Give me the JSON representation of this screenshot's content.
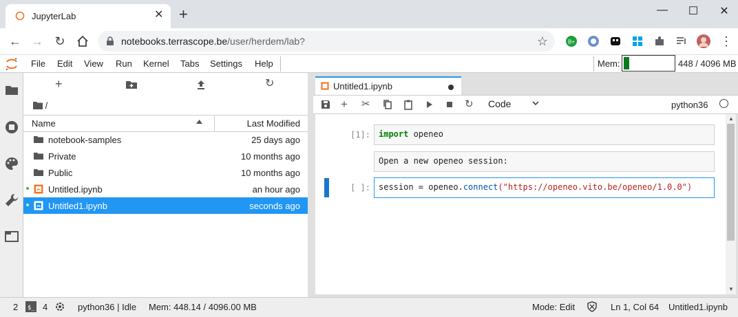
{
  "browser": {
    "tab_title": "JupyterLab",
    "url_host": "notebooks.terrascope.be",
    "url_path": "/user/herdem/lab?"
  },
  "menubar": {
    "items": [
      "File",
      "Edit",
      "View",
      "Run",
      "Kernel",
      "Tabs",
      "Settings",
      "Help"
    ],
    "memory_label": "Mem:",
    "memory_value": "448 / 4096 MB",
    "memory_fraction": 0.109
  },
  "filebrowser": {
    "breadcrumb": "/",
    "col_name": "Name",
    "col_modified": "Last Modified",
    "rows": [
      {
        "name": "notebook-samples",
        "modified": "25 days ago",
        "kind": "folder"
      },
      {
        "name": "Private",
        "modified": "10 months ago",
        "kind": "folder"
      },
      {
        "name": "Public",
        "modified": "10 months ago",
        "kind": "folder"
      },
      {
        "name": "Untitled.ipynb",
        "modified": "an hour ago",
        "kind": "notebook"
      },
      {
        "name": "Untitled1.ipynb",
        "modified": "seconds ago",
        "kind": "notebook"
      }
    ]
  },
  "notebook": {
    "tab_title": "Untitled1.ipynb",
    "cell_type": "Code",
    "kernel": "python36",
    "cells": [
      {
        "prompt": "[1]:",
        "kw": "import",
        "text": " openeo"
      },
      {
        "prompt": "",
        "text": "Open a new openeo session:"
      },
      {
        "prompt": "[ ]:",
        "pre": "session = openeo.",
        "fn": "connect",
        "str": "(\"https://openeo.vito.be/openeo/1.0.0\")"
      }
    ]
  },
  "status": {
    "terminals": "2",
    "kernels": "4",
    "kernel_state": "python36 | Idle",
    "memory": "Mem: 448.14 / 4096.00 MB",
    "mode": "Mode: Edit",
    "cursor": "Ln 1, Col 64",
    "file": "Untitled1.ipynb"
  },
  "colors": {
    "accent": "#2196f3",
    "jupyter_orange": "#f37726",
    "memory_fill": "#0a7a1f"
  }
}
